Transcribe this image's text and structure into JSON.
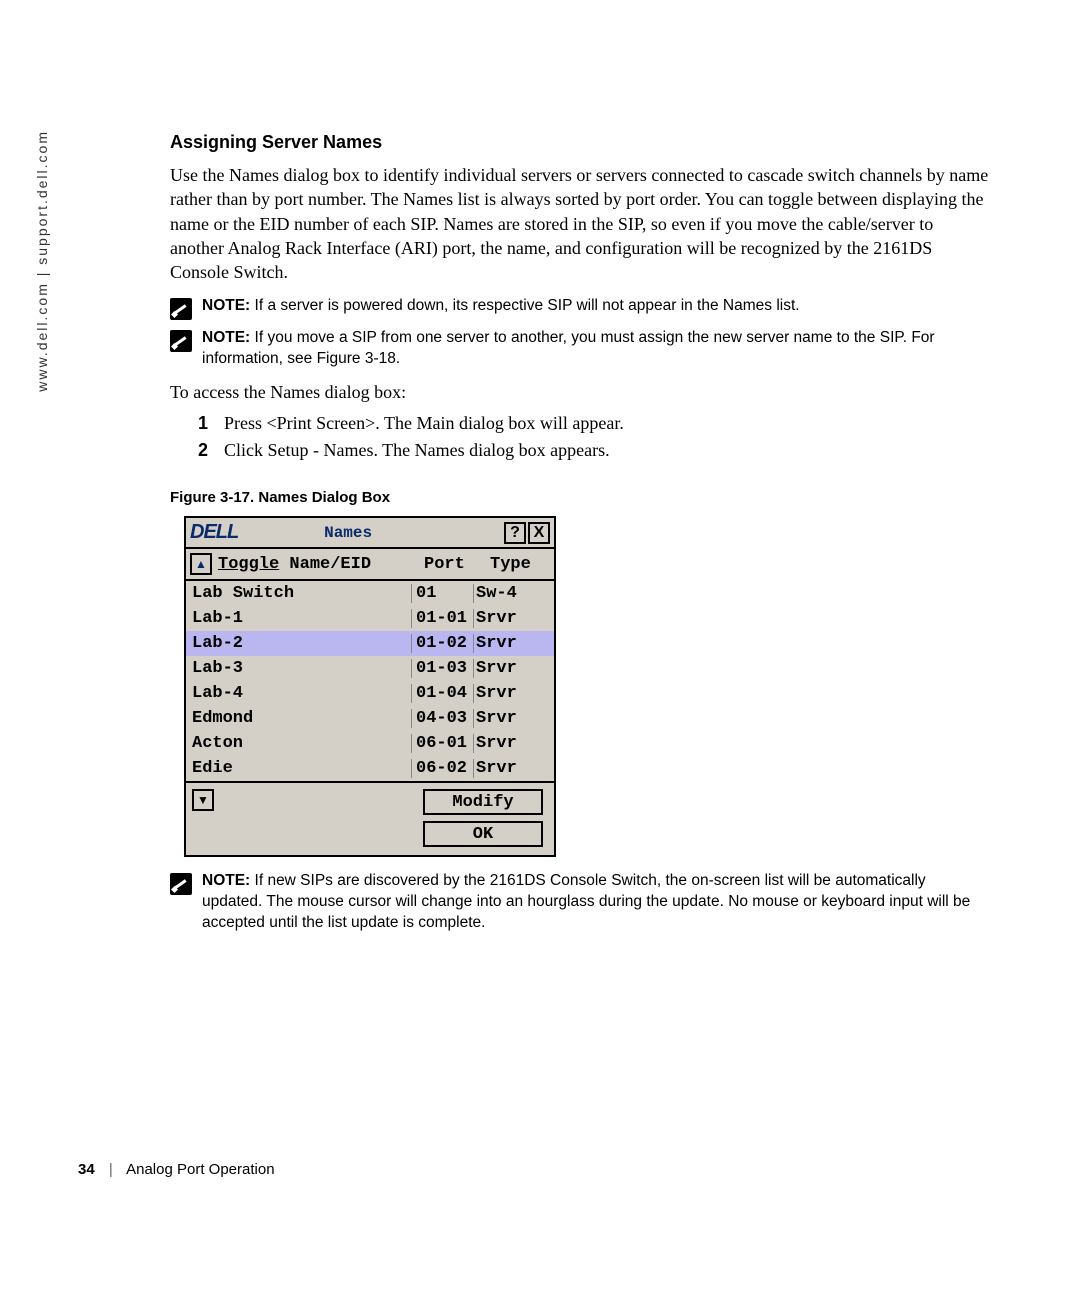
{
  "side_url": "www.dell.com | support.dell.com",
  "section_heading": "Assigning Server Names",
  "intro_paragraph": "Use the Names dialog box to identify individual servers or servers connected to cascade switch channels by name rather than by port number. The Names list is always sorted by port order. You can toggle between displaying the name or the EID number of each SIP. Names are stored in the SIP, so even if you move the cable/server to another Analog Rack Interface (ARI) port, the name, and configuration will be recognized by the 2161DS Console Switch.",
  "notes": {
    "label": "NOTE:",
    "a": " If a server is powered down, its respective SIP will not appear in the Names list.",
    "b": " If you move a SIP from one server to another, you must assign the new server name to the SIP. For information, see Figure 3-18.",
    "c": " If new SIPs are discovered by the 2161DS Console Switch, the on-screen list will be automatically updated. The mouse cursor will change into an hourglass during the update. No mouse or keyboard input will be accepted until the list update is complete."
  },
  "access_line": "To access the Names dialog box:",
  "steps": [
    {
      "n": "1",
      "t": "Press <Print Screen>. The Main dialog box will appear."
    },
    {
      "n": "2",
      "t": "Click Setup - Names. The Names dialog box appears."
    }
  ],
  "figure_caption": "Figure 3-17.    Names Dialog Box",
  "dialog": {
    "logo": "DELL",
    "title": "Names",
    "help": "?",
    "close": "X",
    "headers": {
      "toggle": "Toggle",
      "nameeid": "Name/EID",
      "port": "Port",
      "type": "Type"
    },
    "rows": [
      {
        "name": "Lab Switch",
        "port": "01",
        "type": "Sw-4",
        "sel": false
      },
      {
        "name": "Lab-1",
        "port": "01-01",
        "type": "Srvr",
        "sel": false
      },
      {
        "name": "Lab-2",
        "port": "01-02",
        "type": "Srvr",
        "sel": true
      },
      {
        "name": "Lab-3",
        "port": "01-03",
        "type": "Srvr",
        "sel": false
      },
      {
        "name": "Lab-4",
        "port": "01-04",
        "type": "Srvr",
        "sel": false
      },
      {
        "name": "Edmond",
        "port": "04-03",
        "type": "Srvr",
        "sel": false
      },
      {
        "name": "Acton",
        "port": "06-01",
        "type": "Srvr",
        "sel": false
      },
      {
        "name": "Edie",
        "port": "06-02",
        "type": "Srvr",
        "sel": false
      }
    ],
    "modify_btn": "Modify",
    "ok_btn": "OK"
  },
  "footer": {
    "page": "34",
    "section": "Analog Port Operation"
  }
}
